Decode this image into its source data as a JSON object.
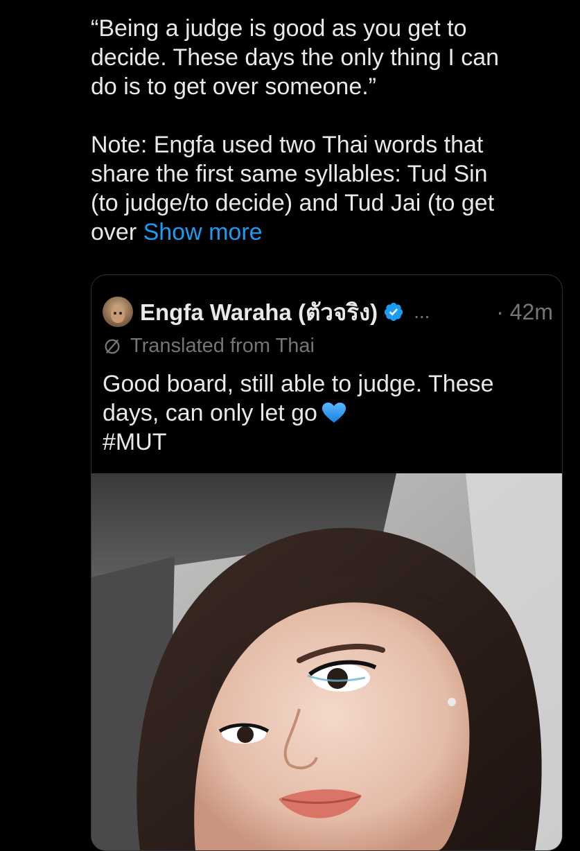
{
  "tweet": {
    "text_lines": [
      "“Being a judge is good as you get to",
      "decide. These days the only thing I can",
      "do is to get over someone.”"
    ],
    "note_lines": [
      "Note: Engfa used two Thai words that",
      "share the first same syllables: Tud Sin",
      "(to judge/to decide) and Tud  Jai (to get",
      "over"
    ],
    "show_more": "Show more"
  },
  "quote": {
    "display_name": "Engfa Waraha (ตัวจริง)",
    "ellipsis": "...",
    "timestamp": "· 42m",
    "translated_label": "Translated from Thai",
    "text_lines": [
      "Good board, still able to judge. These",
      "days, can only let go",
      "#MUT"
    ],
    "heart_emoji": "blue-heart-icon",
    "media_alt": "selfie photo"
  },
  "colors": {
    "background": "#000000",
    "text": "#e7e9ea",
    "secondary": "#71767b",
    "link": "#1d9bf0",
    "verified": "#1d9bf0",
    "border": "#2f3336"
  }
}
